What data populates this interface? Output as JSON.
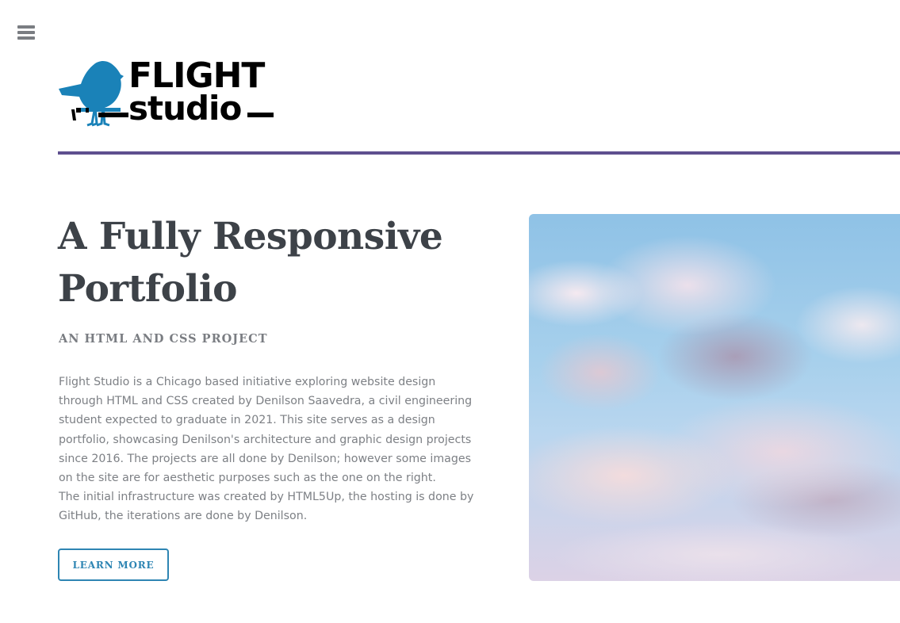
{
  "nav": {
    "menu_icon": "hamburger-menu-icon"
  },
  "logo": {
    "word_top": "FLIGHT",
    "word_bottom": "studio",
    "bird_icon": "bird-icon",
    "bird_color": "#1a82b8"
  },
  "colors": {
    "divider": "#5e4f8f",
    "accent": "#2e85b3",
    "heading": "#3d4248",
    "body_text": "#7d8085"
  },
  "hero": {
    "title": "A Fully Responsive Portfolio",
    "subtitle": "AN HTML AND CSS PROJECT",
    "paragraphs": [
      "Flight Studio is a Chicago based initiative exploring website design through HTML and CSS created by Denilson Saavedra, a civil engineering student expected to graduate in 2021. This site serves as a design portfolio, showcasing Denilson's architecture and graphic design projects since 2016. The projects are all done by Denilson; however some images on the site are for aesthetic purposes such as the one on the right.",
      "The initial infrastructure was created by HTML5Up, the hosting is done by GitHub, the iterations are done by Denilson."
    ],
    "button_label": "LEARN MORE",
    "image": "clouds-photo"
  }
}
